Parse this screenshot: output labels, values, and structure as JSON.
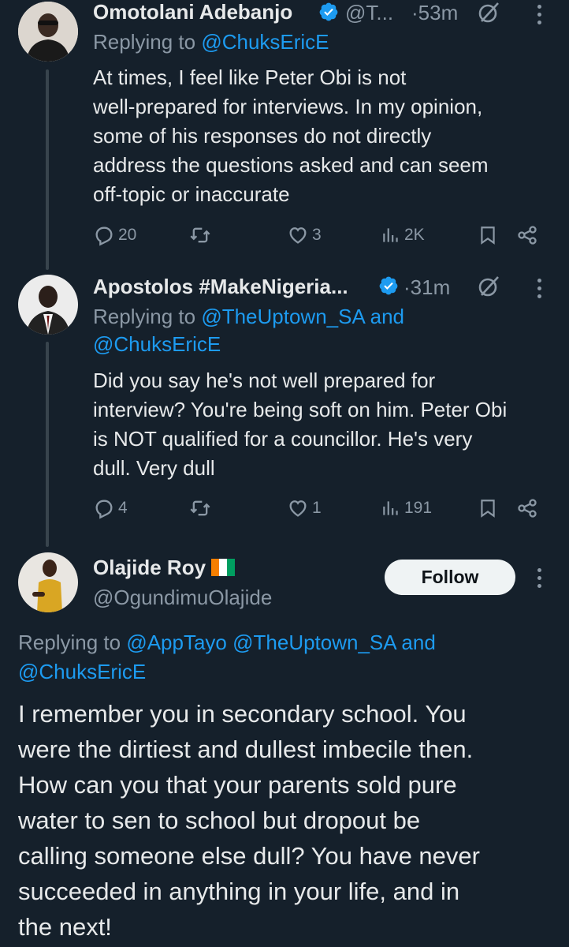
{
  "tweets": [
    {
      "author_name": "Omotolani Adebanjo",
      "handle_truncated": "@T...",
      "time": "·53m",
      "replying_prefix": "Replying to",
      "replying_to": "@ChuksEricE",
      "text_lines": [
        "At times, I feel like Peter Obi is not",
        "well-prepared for interviews. In my opinion,",
        "some of his responses do not directly",
        "address the questions asked and can seem",
        "off-topic or inaccurate"
      ],
      "replies": "20",
      "likes": "3",
      "views": "2K",
      "verified": true
    },
    {
      "author_name": "Apostolos #MakeNigeria...",
      "time": "·31m",
      "replying_prefix": "Replying to",
      "replying_to_1": "@TheUptown_SA",
      "replying_and": "and",
      "replying_to_2": "@ChuksEricE",
      "text_lines": [
        "Did you say he's not well prepared for",
        "interview? You're being soft on him. Peter Obi",
        "is NOT qualified for a councillor. He's very",
        "dull. Very dull"
      ],
      "replies": "4",
      "likes": "1",
      "views": "191",
      "verified": true
    }
  ],
  "main_tweet": {
    "author_name": "Olajide Roy",
    "flag_emoji": "🇨🇮",
    "handle": "@OgundimuOlajide",
    "follow_label": "Follow",
    "replying_prefix": "Replying to",
    "replying_to_1": "@AppTayo",
    "replying_to_2": "@TheUptown_SA",
    "replying_and": "and",
    "replying_to_3": "@ChuksEricE",
    "text_lines": [
      "I remember you in secondary school. You",
      "were the dirtiest and dullest imbecile then.",
      "How can you that your parents sold pure",
      "water to sen to school but dropout be",
      "calling someone else dull? You have never",
      "succeeded in anything in your life, and in",
      "the next!"
    ]
  },
  "colors": {
    "background": "#15202b",
    "link": "#1d9bf0",
    "muted": "#8b98a5",
    "text": "#e7e9ea",
    "verified": "#1d9bf0"
  },
  "icons": [
    "reply-icon",
    "retweet-icon",
    "like-icon",
    "views-icon",
    "bookmark-icon",
    "share-icon",
    "grok-icon",
    "more-icon",
    "verified-badge-icon"
  ]
}
